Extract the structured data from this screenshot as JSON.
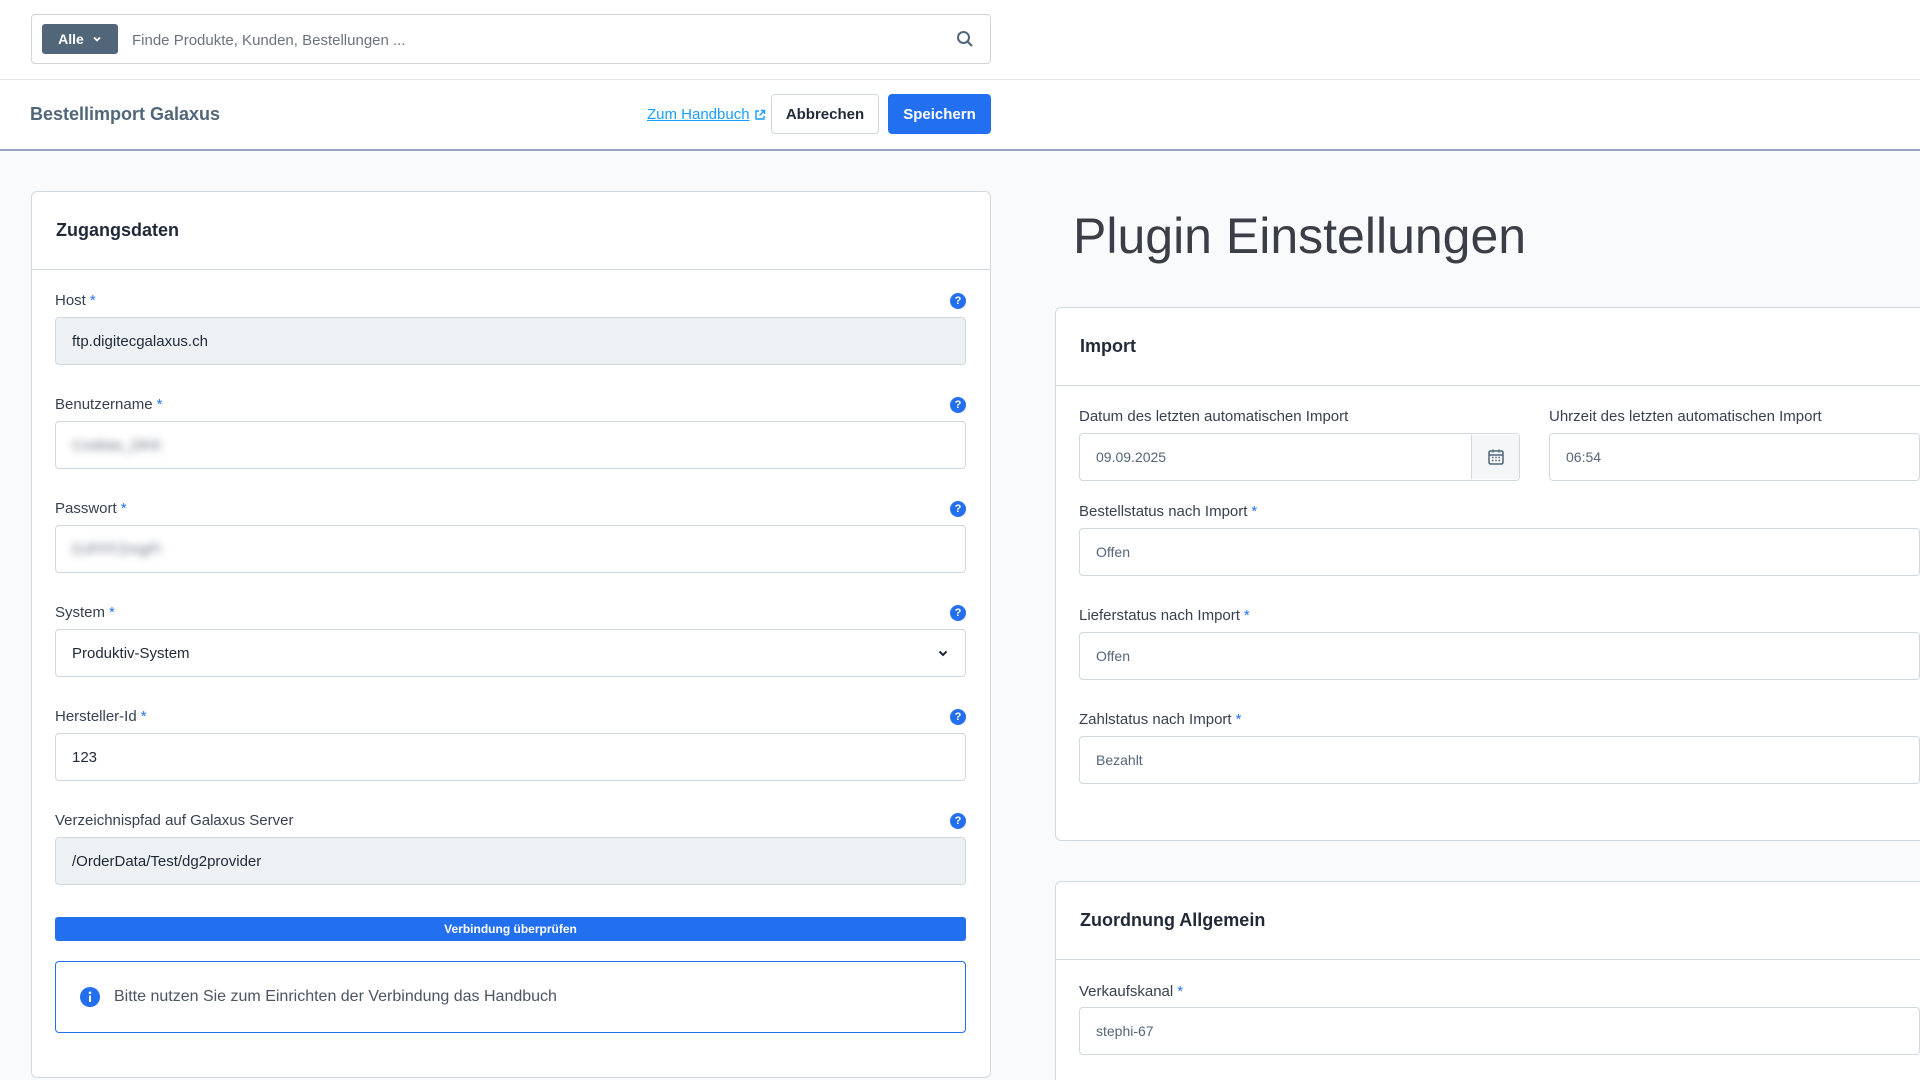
{
  "search": {
    "scope_label": "Alle",
    "placeholder": "Finde Produkte, Kunden, Bestellungen ..."
  },
  "header": {
    "title": "Bestellimport Galaxus",
    "manual_link": "Zum Handbuch",
    "cancel_label": "Abbrechen",
    "save_label": "Speichern"
  },
  "access": {
    "title": "Zugangsdaten",
    "host_label": "Host",
    "host_value": "ftp.digitecgalaxus.ch",
    "username_label": "Benutzername",
    "username_value": "Cosbas_DKK",
    "password_label": "Passwort",
    "password_value": "DJFFFZmgPi",
    "system_label": "System",
    "system_value": "Produktiv-System",
    "manufacturer_label": "Hersteller-Id",
    "manufacturer_value": "123",
    "path_label": "Verzeichnispfad auf Galaxus Server",
    "path_value": "/OrderData/Test/dg2provider",
    "verify_label": "Verbindung überprüfen",
    "info_text": "Bitte nutzen Sie zum Einrichten der Verbindung das Handbuch",
    "required_mark": "*",
    "help_glyph": "?"
  },
  "plugin": {
    "title": "Plugin Einstellungen"
  },
  "import": {
    "title": "Import",
    "date_label": "Datum des letzten automatischen Import",
    "date_value": "09.09.2025",
    "time_label": "Uhrzeit des letzten automatischen Import",
    "time_value": "06:54",
    "order_status_label": "Bestellstatus nach Import",
    "order_status_value": "Offen",
    "delivery_status_label": "Lieferstatus nach Import",
    "delivery_status_value": "Offen",
    "payment_status_label": "Zahlstatus nach Import",
    "payment_status_value": "Bezahlt"
  },
  "mapping": {
    "title": "Zuordnung Allgemein",
    "sales_channel_label": "Verkaufskanal",
    "sales_channel_value": "stephi-67"
  },
  "colors": {
    "primary": "#2270f0",
    "scope_bg": "#52667a",
    "link": "#189eff"
  }
}
